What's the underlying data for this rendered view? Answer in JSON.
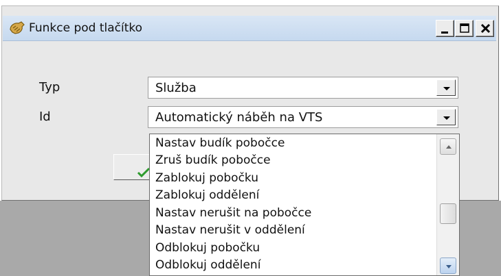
{
  "window": {
    "title": "Funkce pod tlačítko",
    "controls": {
      "minimize": "_",
      "maximize": "□",
      "close": "×"
    }
  },
  "form": {
    "type_label": "Typ",
    "type_value": "Služba",
    "id_label": "Id",
    "id_value": "Automatický náběh na VTS"
  },
  "dropdown": {
    "items": [
      "Nastav budík pobočce",
      "Zruš budík pobočce",
      "Zablokuj pobočku",
      "Zablokuj oddělení",
      "Nastav nerušit na pobočce",
      "Nastav nerušit v oddělení",
      "Odblokuj pobočku",
      "Odblokuj oddělení"
    ]
  },
  "colors": {
    "titlebar": "#c6d9ef",
    "window_bg": "#e8e8e8",
    "backdrop": "#a9a9a9",
    "ok_check": "#2e9b2e"
  },
  "icons": {
    "app": "phone-handset-icon",
    "ok": "checkmark-icon",
    "combo_arrow": "chevron-down-icon"
  }
}
